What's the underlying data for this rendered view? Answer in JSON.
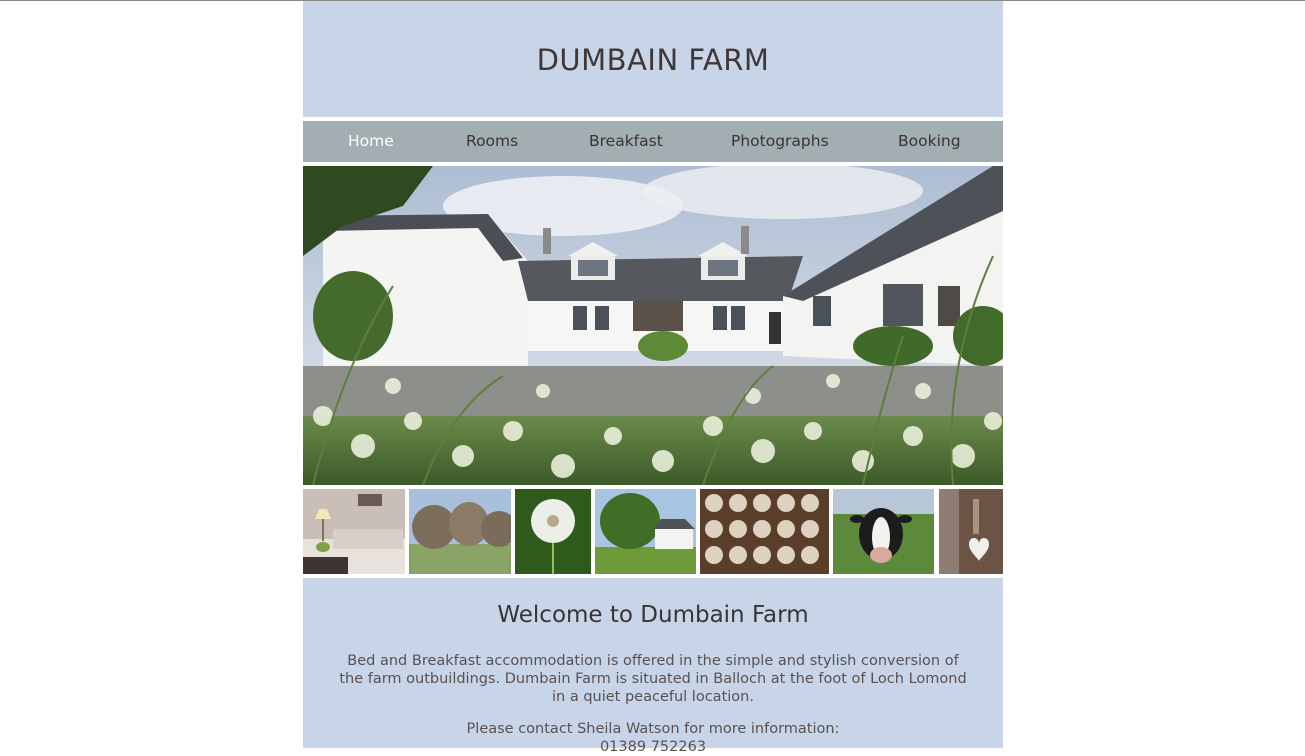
{
  "site": {
    "title": "DUMBAIN FARM"
  },
  "nav": {
    "items": [
      {
        "label": "Home",
        "active": true
      },
      {
        "label": "Rooms",
        "active": false
      },
      {
        "label": "Breakfast",
        "active": false
      },
      {
        "label": "Photographs",
        "active": false
      },
      {
        "label": "Booking",
        "active": false
      }
    ]
  },
  "colors": {
    "header_bg": "#c8d5e9",
    "nav_bg": "#a3aeb3",
    "nav_active_text": "#ffffff",
    "text": "#3a3434"
  },
  "thumbnails": [
    {
      "subject": "bedroom-lamp"
    },
    {
      "subject": "winter-trees"
    },
    {
      "subject": "dandelion-clock"
    },
    {
      "subject": "farmhouse-tree"
    },
    {
      "subject": "baked-pastries"
    },
    {
      "subject": "cow"
    },
    {
      "subject": "heart-decoration"
    }
  ],
  "main": {
    "heading": "Welcome to Dumbain Farm",
    "intro": "Bed and Breakfast accommodation is offered in the simple and stylish conversion of the farm outbuildings. Dumbain Farm is situated in Balloch at the foot of Loch Lomond in a quiet peaceful location.",
    "contact_line": "Please contact Sheila Watson for more information:",
    "phone": "01389 752263"
  }
}
